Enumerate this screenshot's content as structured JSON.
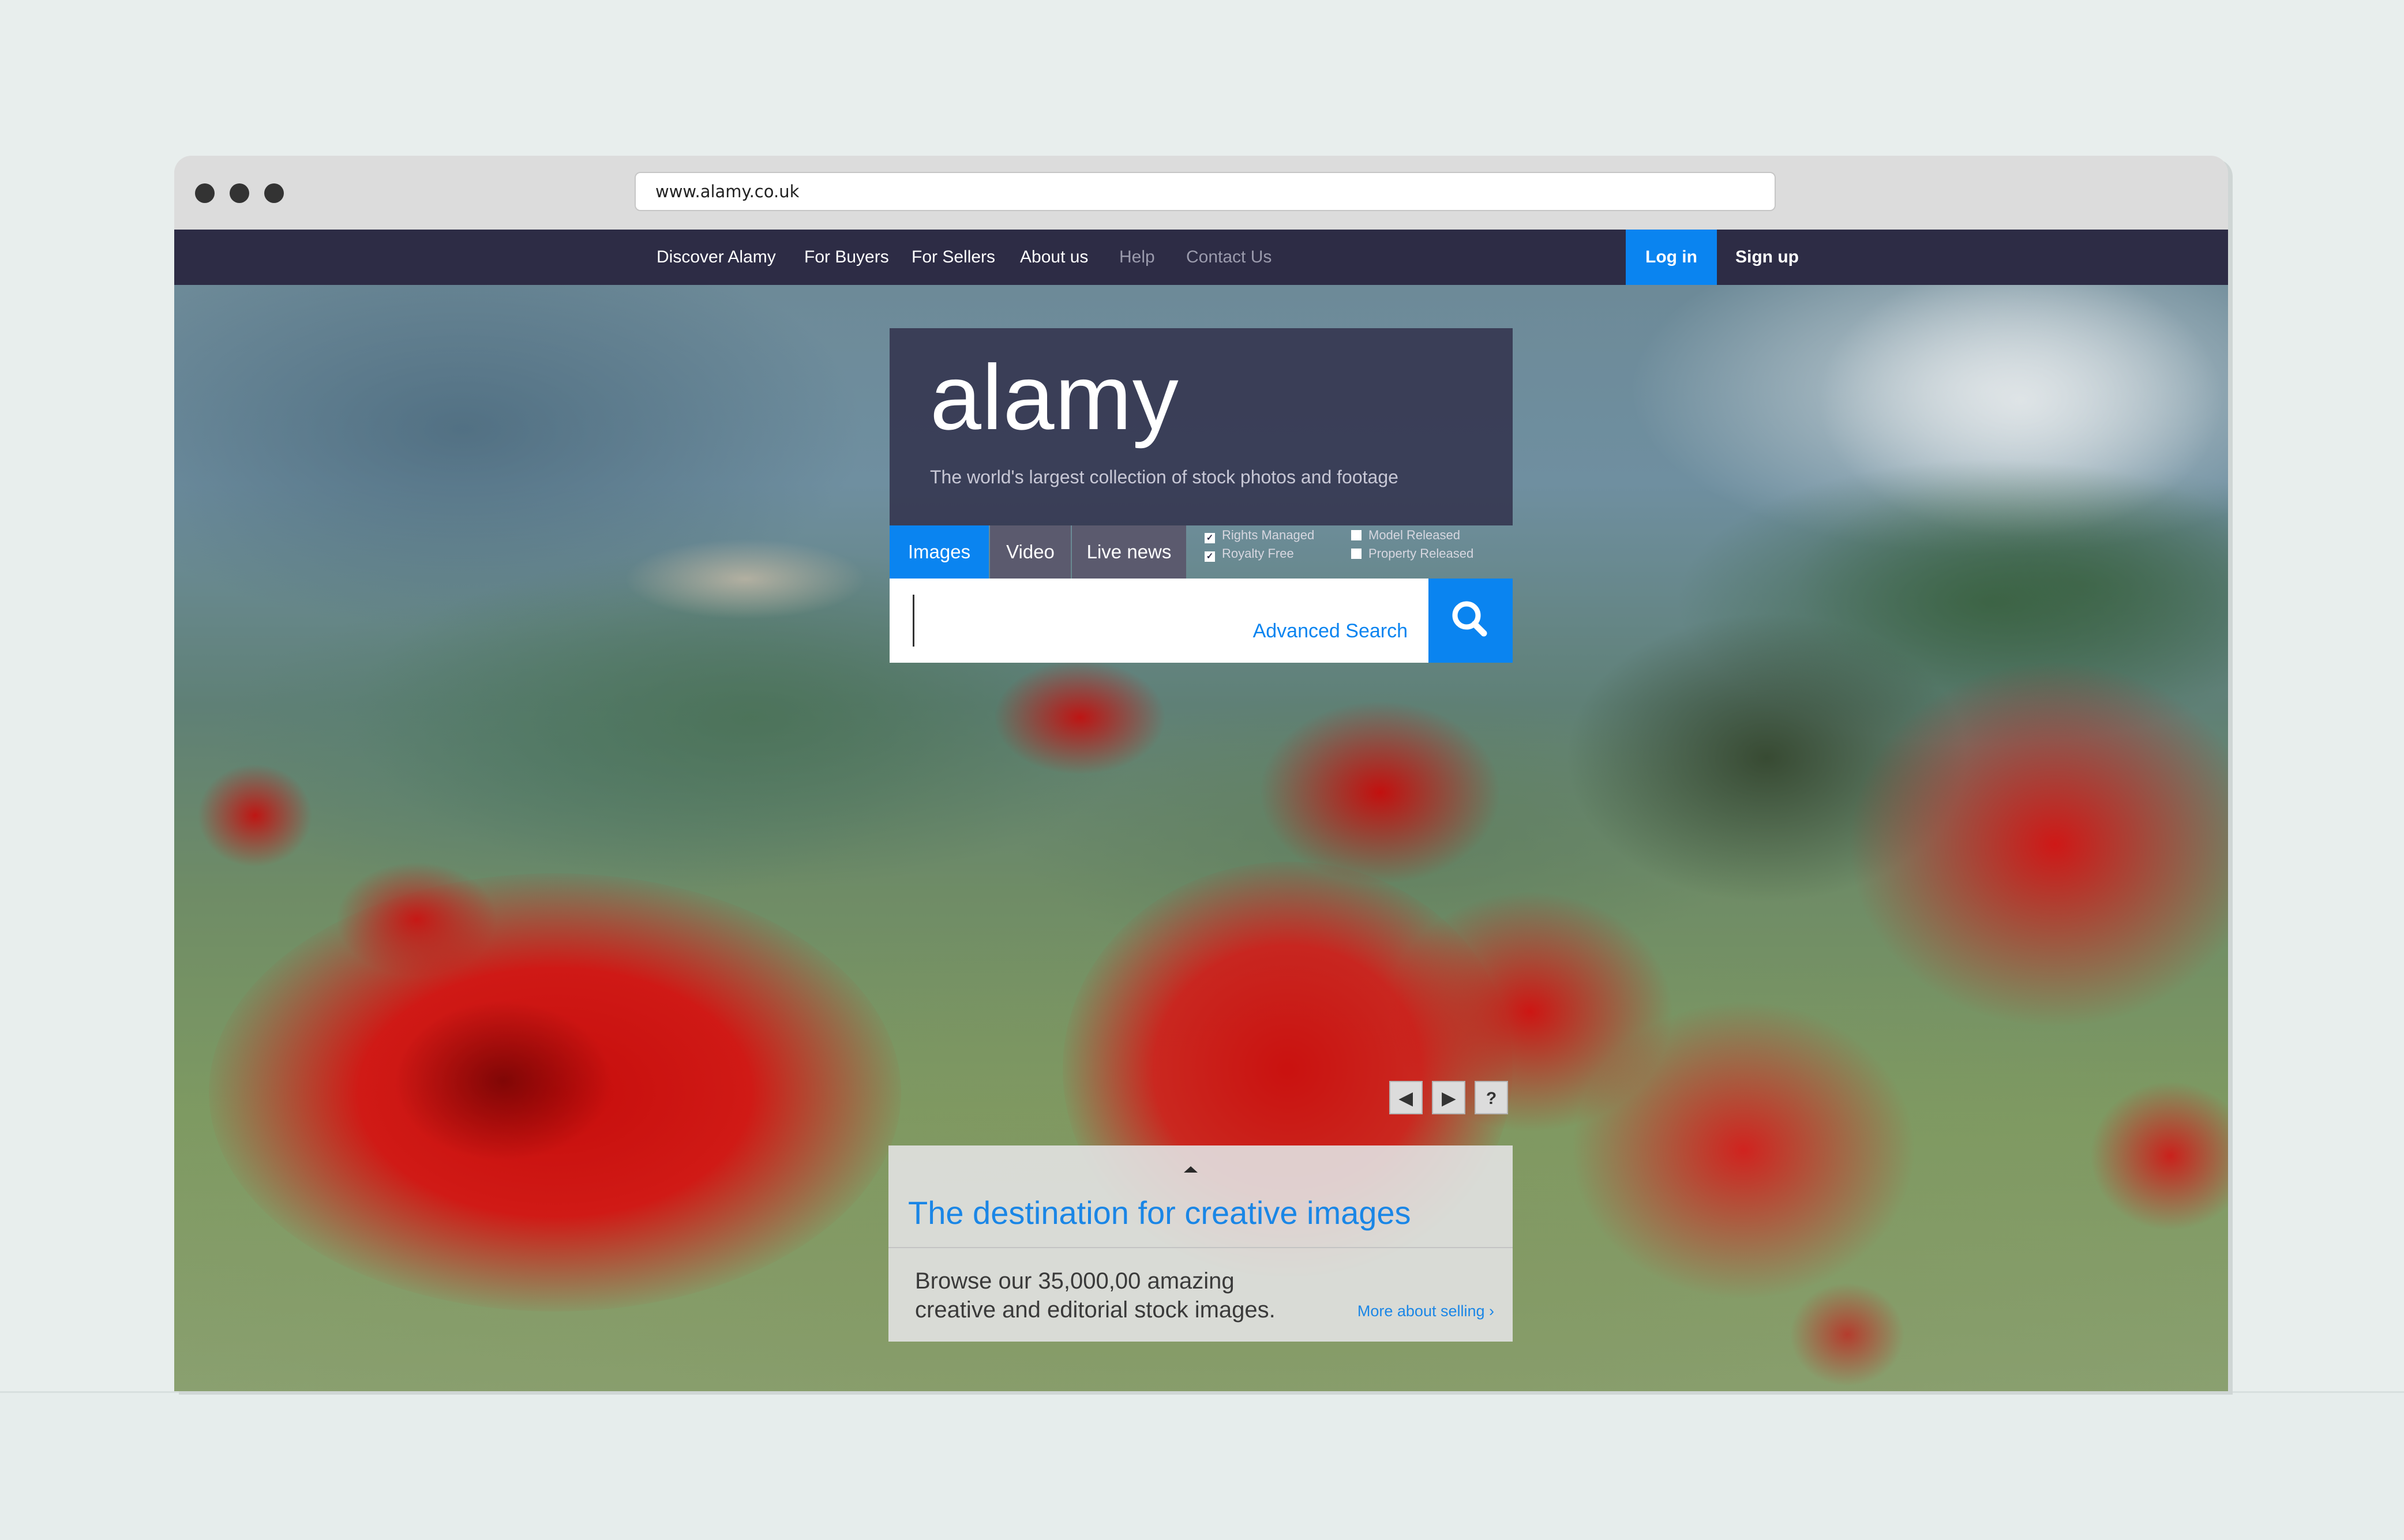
{
  "browser": {
    "url": "www.alamy.co.uk"
  },
  "nav": {
    "items": [
      {
        "label": "Discover Alamy"
      },
      {
        "label": "For Buyers"
      },
      {
        "label": "For Sellers"
      },
      {
        "label": "About us"
      },
      {
        "label": "Help"
      },
      {
        "label": "Contact Us"
      }
    ],
    "login": "Log in",
    "signup": "Sign up"
  },
  "search": {
    "logo": "alamy",
    "tagline": "The world's largest collection of stock photos and footage",
    "tabs": [
      {
        "label": "Images",
        "active": true
      },
      {
        "label": "Video",
        "active": false
      },
      {
        "label": "Live news",
        "active": false
      }
    ],
    "filters": [
      {
        "label": "Rights Managed",
        "checked": true
      },
      {
        "label": "Royalty Free",
        "checked": true
      },
      {
        "label": "Model Released",
        "checked": false
      },
      {
        "label": "Property Released",
        "checked": false
      }
    ],
    "query": "",
    "advanced_label": "Advanced Search",
    "button_icon": "search-icon"
  },
  "slideshow": {
    "prev_icon": "◀",
    "next_icon": "▶",
    "help_icon": "?"
  },
  "promo": {
    "title": "The destination for creative images",
    "body_line1": "Browse our 35,000,00 amazing",
    "body_line2": "creative and editorial stock images.",
    "link": "More about selling ›"
  },
  "colors": {
    "nav_bg": "#2d2c45",
    "accent": "#0a84f0",
    "poppy": "#d40f0f"
  }
}
